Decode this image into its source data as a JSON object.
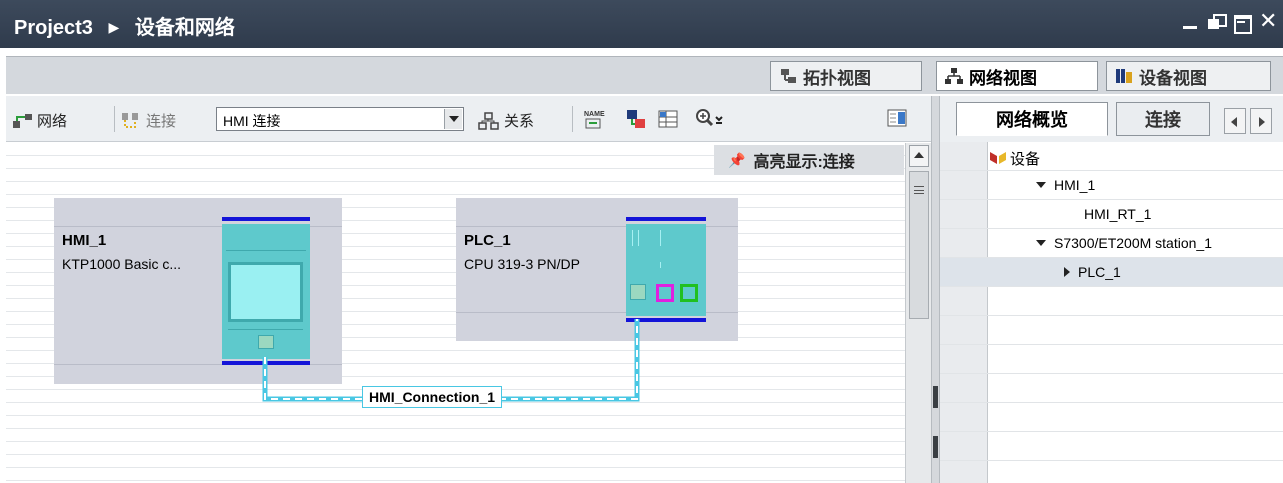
{
  "window": {
    "project": "Project3",
    "section": "设备和网络"
  },
  "view_tabs": {
    "topology": "拓扑视图",
    "network": "网络视图",
    "device": "设备视图"
  },
  "toolbar": {
    "network_label": "网络",
    "connect_label": "连接",
    "connection_type": "HMI 连接",
    "relations_label": "关系"
  },
  "canvas": {
    "highlight_label": "高亮显示:连接",
    "devices": [
      {
        "name": "HMI_1",
        "type": "KTP1000 Basic c..."
      },
      {
        "name": "PLC_1",
        "type": "CPU 319-3 PN/DP"
      }
    ],
    "connection_label": "HMI_Connection_1"
  },
  "colors": {
    "titlebar": "#2f3b4c",
    "device_bg": "#d1d3dd",
    "device_module": "#5ec9cc",
    "rack_bar": "#1414d8",
    "connection_line": "#49c7e3"
  },
  "right_panel": {
    "tabs": [
      "网络概览",
      "连接"
    ],
    "tree_header": "设备",
    "tree": [
      {
        "label": "HMI_1",
        "expander": "expanded"
      },
      {
        "label": "HMI_RT_1",
        "expander": "none"
      },
      {
        "label": "S7300/ET200M station_1",
        "expander": "expanded"
      },
      {
        "label": "PLC_1",
        "expander": "collapsed",
        "selected": true
      }
    ]
  }
}
